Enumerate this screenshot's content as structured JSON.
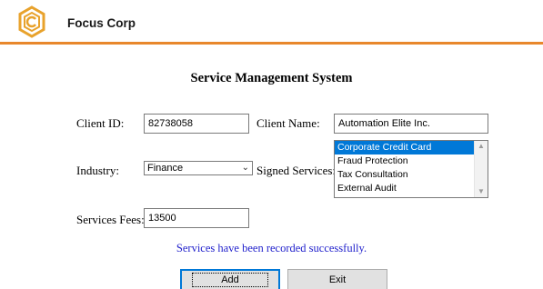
{
  "header": {
    "company_name": "Focus Corp",
    "accent_color": "#e8872c",
    "logo_icon": "hexagon-c-logo"
  },
  "form": {
    "title": "Service Management System",
    "client_id": {
      "label": "Client ID:",
      "value": "82738058"
    },
    "client_name": {
      "label": "Client Name:",
      "value": "Automation Elite Inc."
    },
    "industry": {
      "label": "Industry:",
      "selected": "Finance"
    },
    "signed_services": {
      "label": "Signed Services:",
      "items": [
        "Corporate Credit Card",
        "Fraud Protection",
        "Tax Consultation",
        "External Audit"
      ],
      "selected_index": 0
    },
    "services_fees": {
      "label": "Services Fees:",
      "value": "13500"
    }
  },
  "status_message": "Services have been recorded successfully.",
  "status_color": "#2222cc",
  "buttons": {
    "add": "Add",
    "exit": "Exit"
  }
}
